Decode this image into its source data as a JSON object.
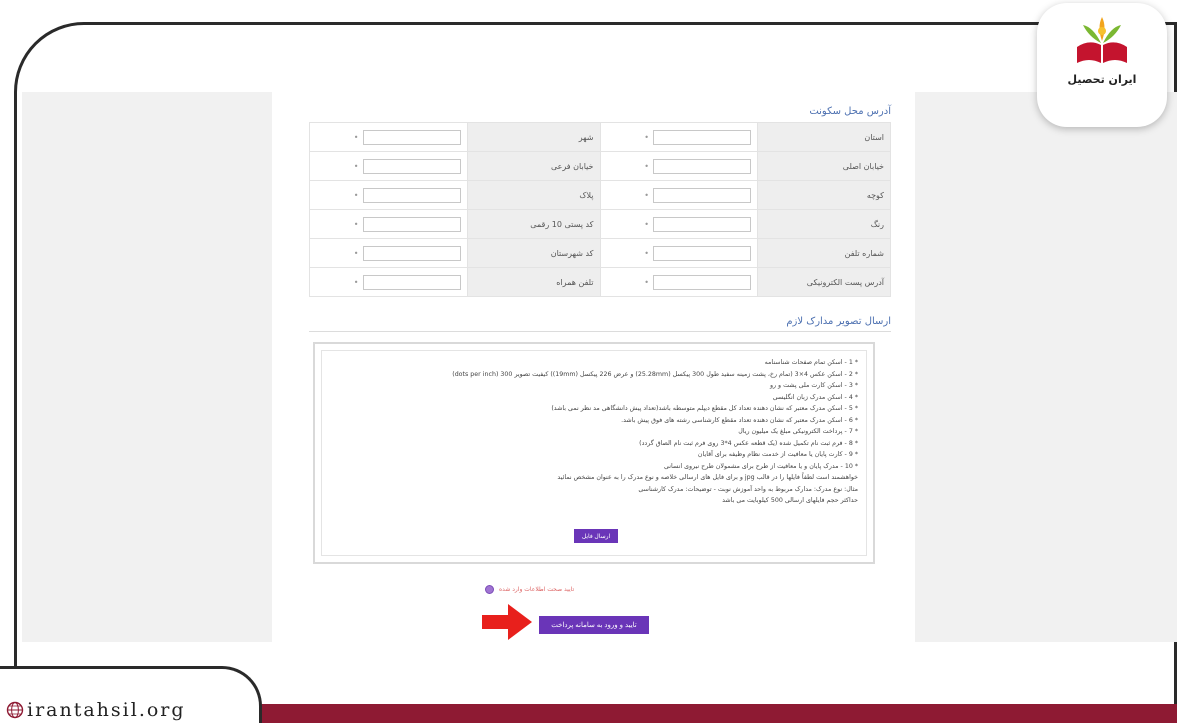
{
  "logo": {
    "text": "ایران تحصیل"
  },
  "site": {
    "url": "irantahsil.org"
  },
  "address_section": {
    "title": "آدرس محل سکونت",
    "rows": [
      {
        "right_label": "استان",
        "left_label": "شهر"
      },
      {
        "right_label": "خیابان اصلی",
        "left_label": "خیابان فرعی"
      },
      {
        "right_label": "کوچه",
        "left_label": "پلاک"
      },
      {
        "right_label": "رنگ",
        "left_label": "کد پستی 10 رقمی"
      },
      {
        "right_label": "شماره تلفن",
        "left_label": "کد شهرستان"
      },
      {
        "right_label": "آدرس پست الکترونیکی",
        "left_label": "تلفن همراه"
      }
    ]
  },
  "docs_section": {
    "title": "ارسال تصویر مدارک لازم",
    "items": [
      "* 1 - اسکن تمام صفحات شناسنامه",
      "* 2 - اسکن عکس 4×3 (تمام رخ، پشت زمینه سفید طول 300 پیکسل (25.28mm) و عرض 226 پیکسل (19mm)) کیفیت تصویر 300 (dots per inch)",
      "* 3 - اسکن کارت ملی پشت و رو",
      "* 4 - اسکن مدرک زبان انگلیسی",
      "* 5 - اسکن مدرک معتبر که نشان دهنده تعداد کل مقطع دیپلم متوسطه باشد(تعداد پیش دانشگاهی مد نظر نمی باشد)",
      "* 6 - اسکن مدرک معتبر که نشان دهنده تعداد مقطع کارشناسی رشته های فوق پیش باشد.",
      "* 7 - پرداخت الکترونیکی مبلغ یک میلیون ریال",
      "* 8 - فرم ثبت نام تکمیل شده (یک قطعه عکس 4*3 روی فرم ثبت نام الصاق گردد)",
      "* 9 - کارت پایان یا معافیت از خدمت نظام وظیفه برای آقایان",
      "* 10 - مدرک پایان و یا معافیت از طرح برای مشمولان طرح نیروی انسانی"
    ],
    "notes": [
      "خواهشمند است لطفاً فایلها را در قالب jpg و برای فایل های ارسالی خلاصه و نوع مدرک را به عنوان مشخص نمائید",
      "مثال: نوع مدرک: مدارک مربوط به واحد آموزش نوبت - توضیحات: مدرک کارشناسی",
      "حداکثر حجم فایلهای ارسالی 500 کیلوبایت می باشد"
    ],
    "upload_label": "ارسال فایل"
  },
  "confirm": {
    "text": "تایید صحت اطلاعات وارد شده"
  },
  "submit": {
    "label": "تایید و ورود به سامانه پرداخت"
  },
  "colors": {
    "accent": "#6a35b8",
    "band": "#8e1a33",
    "link": "#4b6fb0",
    "warning": "#e0281f"
  }
}
